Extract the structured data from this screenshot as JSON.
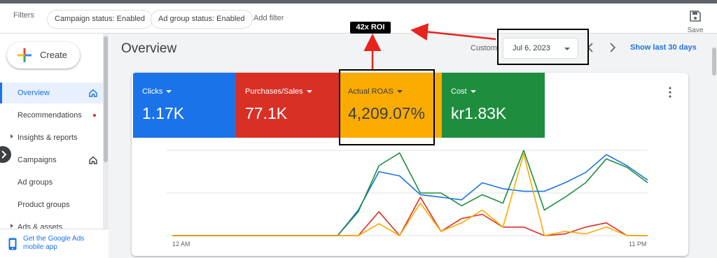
{
  "filters": {
    "label": "Filters",
    "chips": [
      "Campaign status: Enabled",
      "Ad group status: Enabled"
    ],
    "add_filter": "Add filter"
  },
  "toolbar": {
    "save_label": "Save",
    "save_icon": "save-icon"
  },
  "sidebar": {
    "create_label": "Create",
    "items": [
      {
        "label": "Overview",
        "active": true,
        "icon": "home-icon"
      },
      {
        "label": "Recommendations",
        "badge": "red-dot"
      },
      {
        "label": "Insights & reports",
        "expandable": true
      },
      {
        "label": "Campaigns",
        "icon": "home-icon"
      },
      {
        "label": "Ad groups"
      },
      {
        "label": "Product groups"
      },
      {
        "label": "Ads & assets",
        "expandable": true
      }
    ],
    "mobile_app": "Get the Google Ads mobile app"
  },
  "header": {
    "title": "Overview",
    "custom_label": "Custom",
    "date_value": "Jul 6, 2023",
    "show_last": "Show last 30 days"
  },
  "metrics": [
    {
      "label": "Clicks",
      "value": "1.17K",
      "color": "#1a73e8"
    },
    {
      "label": "Purchases/Sales",
      "value": "77.1K",
      "color": "#d93025"
    },
    {
      "label": "Actual ROAS",
      "value": "4,209.07%",
      "color": "#f9ab00"
    },
    {
      "label": "Cost",
      "value": "kr1.83K",
      "color": "#1e8e3e"
    }
  ],
  "annotation": {
    "callout": "42x ROI",
    "color": "#e8231d"
  },
  "chart_data": {
    "type": "line",
    "x_start_label": "12 AM",
    "x_end_label": "11 PM",
    "x": [
      0,
      1,
      2,
      3,
      4,
      5,
      6,
      7,
      8,
      9,
      10,
      11,
      12,
      13,
      14,
      15,
      16,
      17,
      18,
      19,
      20,
      21,
      22,
      23
    ],
    "ylim": [
      0,
      100
    ],
    "grid": true,
    "series": [
      {
        "color": "#1a73e8",
        "values": [
          0,
          0,
          0,
          0,
          0,
          0,
          0,
          0,
          0,
          30,
          75,
          70,
          48,
          45,
          42,
          62,
          55,
          52,
          52,
          62,
          74,
          95,
          82,
          65
        ]
      },
      {
        "color": "#1e8e3e",
        "values": [
          0,
          0,
          0,
          0,
          0,
          0,
          0,
          0,
          0,
          28,
          82,
          97,
          50,
          50,
          35,
          48,
          38,
          100,
          30,
          45,
          62,
          90,
          80,
          62
        ]
      },
      {
        "color": "#d93025",
        "values": [
          0,
          0,
          0,
          0,
          0,
          0,
          0,
          0,
          0,
          0,
          28,
          0,
          45,
          5,
          20,
          25,
          10,
          10,
          0,
          2,
          10,
          15,
          0,
          0
        ]
      },
      {
        "color": "#f9ab00",
        "values": [
          0,
          0,
          0,
          0,
          0,
          0,
          0,
          0,
          0,
          0,
          14,
          0,
          38,
          5,
          15,
          30,
          10,
          96,
          0,
          5,
          2,
          10,
          0,
          0
        ]
      }
    ]
  }
}
